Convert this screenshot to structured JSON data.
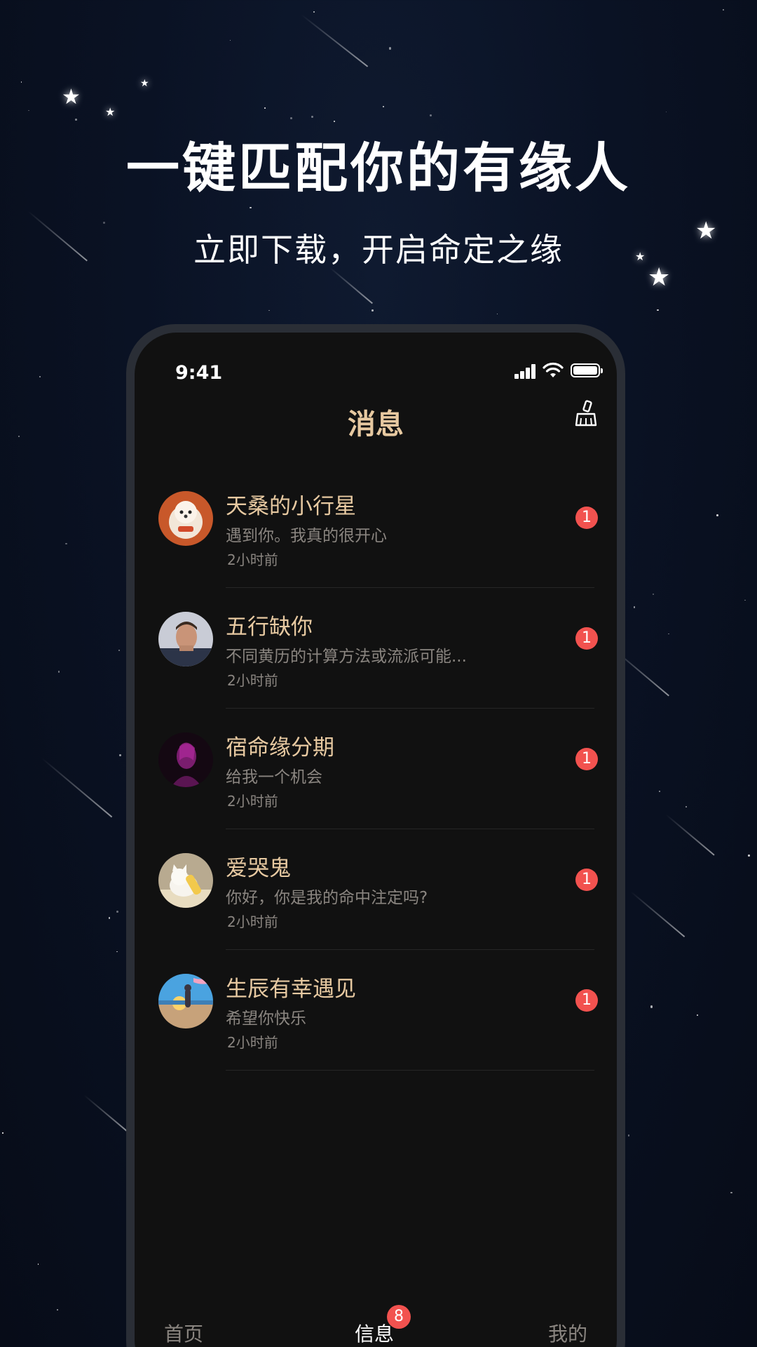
{
  "promo": {
    "title": "一键匹配你的有缘人",
    "subtitle": "立即下载，开启命定之缘"
  },
  "status_bar": {
    "time": "9:41",
    "icons": [
      "signal-icon",
      "wifi-icon",
      "battery-icon"
    ]
  },
  "header": {
    "title": "消息",
    "action_icon": "broom-clear-icon"
  },
  "messages": [
    {
      "name": "天桑的小行星",
      "preview": "遇到你。我真的很开心",
      "time": "2小时前",
      "unread": "1",
      "avatar": "dog-photo"
    },
    {
      "name": "五行缺你",
      "preview": "不同黄历的计算方法或流派可能...",
      "time": "2小时前",
      "unread": "1",
      "avatar": "man-portrait-photo"
    },
    {
      "name": "宿命缘分期",
      "preview": "给我一个机会",
      "time": "2小时前",
      "unread": "1",
      "avatar": "purple-silhouette-photo"
    },
    {
      "name": "爱哭鬼",
      "preview": "你好，你是我的命中注定吗?",
      "time": "2小时前",
      "unread": "1",
      "avatar": "white-cat-photo"
    },
    {
      "name": "生辰有幸遇见",
      "preview": "希望你快乐",
      "time": "2小时前",
      "unread": "1",
      "avatar": "beach-sunset-photo"
    }
  ],
  "tabs": {
    "home": "首页",
    "messages": "信息",
    "messages_badge": "8",
    "mine": "我的",
    "active": "messages"
  },
  "colors": {
    "accent_gold": "#e7c9a1",
    "badge_red": "#f2524f",
    "screen_bg": "#111111",
    "page_bg": "#0a1224"
  }
}
